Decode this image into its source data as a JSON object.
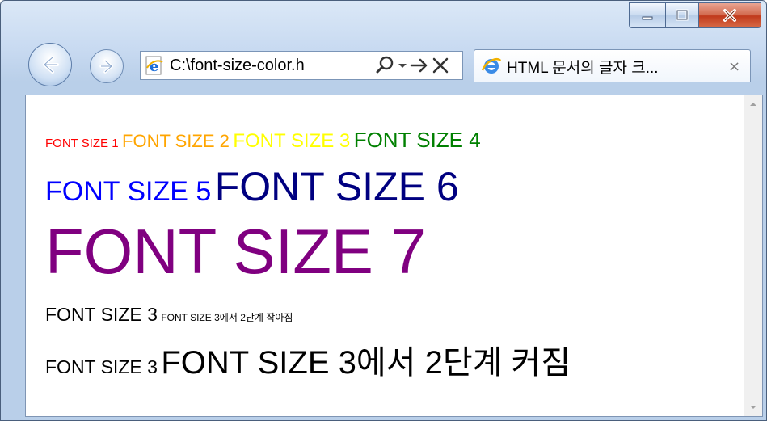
{
  "window": {
    "caption_buttons": {
      "minimize_icon": "minimize-icon",
      "maximize_icon": "maximize-icon",
      "close_icon": "close-icon"
    }
  },
  "address_bar": {
    "url": "C:\\font-size-color.h",
    "icons": [
      "ie-page-icon",
      "search-icon",
      "dropdown-icon",
      "go-arrow-icon",
      "stop-icon"
    ]
  },
  "tab": {
    "title": "HTML 문서의 글자 크...",
    "close_label": "×"
  },
  "page": {
    "line1": [
      {
        "text": "FONT SIZE 1",
        "color": "#ff0000"
      },
      {
        "text": "FONT SIZE 2",
        "color": "#ffa500"
      },
      {
        "text": "FONT SIZE 3",
        "color": "#ffff00"
      },
      {
        "text": "FONT SIZE 4",
        "color": "#008000"
      }
    ],
    "line2": [
      {
        "text": "FONT SIZE 5",
        "color": "#0000ff"
      },
      {
        "text": "FONT SIZE 6",
        "color": "#000080"
      }
    ],
    "line3": [
      {
        "text": "FONT SIZE 7",
        "color": "#800080"
      }
    ],
    "line4": [
      {
        "text": "FONT SIZE 3",
        "color": "#000000"
      },
      {
        "text": "FONT SIZE 3에서 2단계 작아짐",
        "color": "#000000"
      }
    ],
    "line5": [
      {
        "text": "FONT SIZE 3",
        "color": "#000000"
      },
      {
        "text": "FONT SIZE 3에서 2단계 커짐",
        "color": "#000000"
      }
    ]
  }
}
